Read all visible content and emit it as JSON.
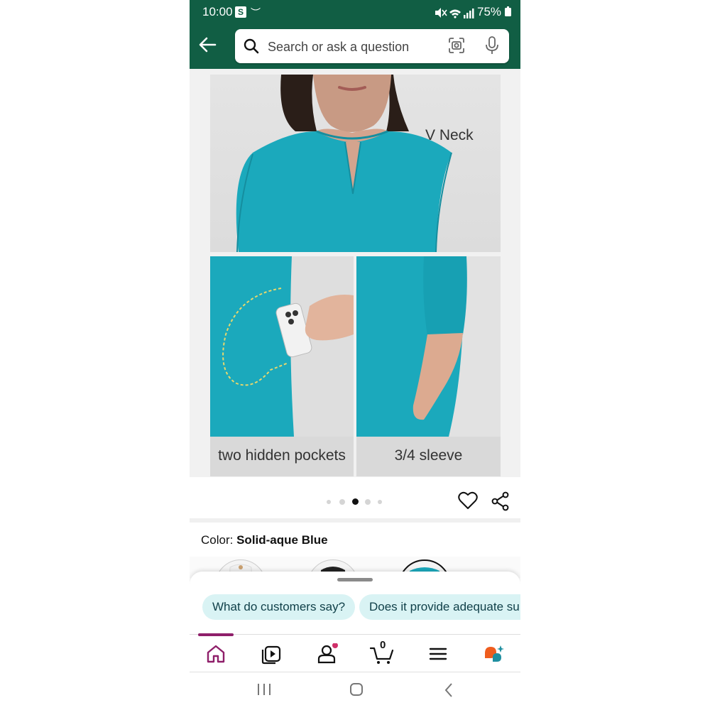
{
  "status_bar": {
    "time": "10:00",
    "app_badge": "S",
    "battery": "75%"
  },
  "search": {
    "placeholder": "Search or ask a question"
  },
  "product_image": {
    "captions": {
      "neck": "V Neck",
      "pockets": "two hidden pockets",
      "sleeve": "3/4 sleeve"
    },
    "pager": {
      "total": 5,
      "active_index": 2
    }
  },
  "color": {
    "label": "Color:",
    "value": "Solid-aque Blue"
  },
  "questions": [
    "What do customers say?",
    "Does it provide adequate su"
  ],
  "cart": {
    "count": "0"
  },
  "colors": {
    "header_green": "#115e44",
    "dress_teal": "#1ba9bc",
    "nav_accent": "#8f1f6a",
    "chip_bg": "#d9f3f4"
  },
  "icons": {
    "nav": [
      "home-icon",
      "video-icon",
      "account-icon",
      "cart-icon",
      "menu-icon",
      "rufus-icon"
    ]
  }
}
